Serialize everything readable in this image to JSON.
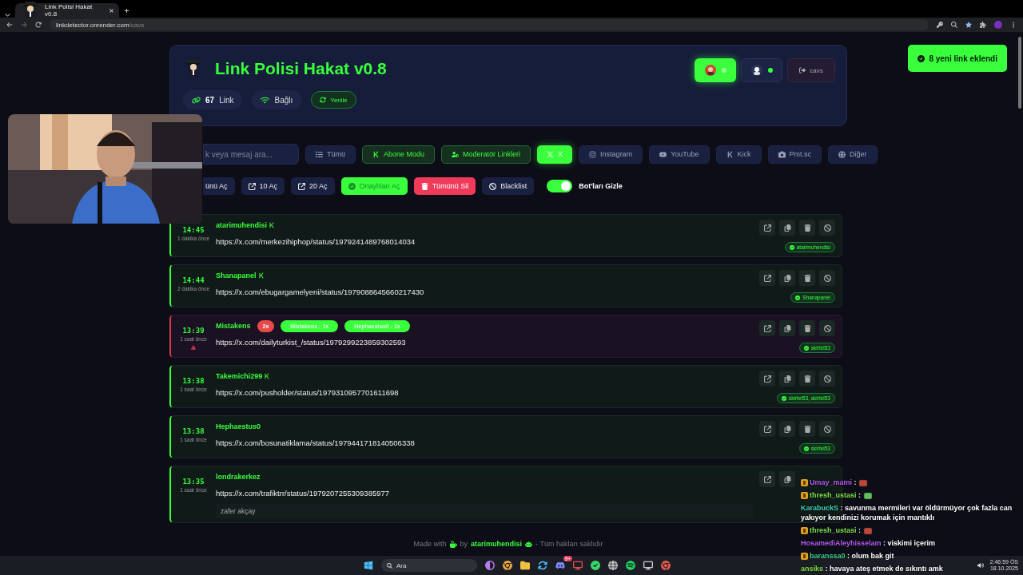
{
  "browser": {
    "tab_title": "Link Polisi Hakat v0.8",
    "url_host": "linkdetector.onrender.com",
    "url_path": "/cavs"
  },
  "header": {
    "title": "Link Polisi Hakat v0.8",
    "link_count": "67",
    "link_label": "Link",
    "connection": "Bağlı",
    "refresh": "Yenile",
    "logout": "cavs",
    "accounts": [
      {
        "selected": true,
        "online": true
      },
      {
        "selected": false,
        "online": true
      }
    ]
  },
  "toast": "8 yeni link eklendi",
  "search": {
    "placeholder": "k veya mesaj ara..."
  },
  "filters": [
    {
      "label": "Tümü",
      "selected": false,
      "kind": "plain"
    },
    {
      "label": "Abone Modu",
      "selected": false,
      "kind": "mode"
    },
    {
      "label": "Moderatör Linkleri",
      "selected": false,
      "kind": "mode"
    },
    {
      "label": "X",
      "selected": true,
      "kind": "plain"
    },
    {
      "label": "Instagram",
      "selected": false,
      "kind": "plain"
    },
    {
      "label": "YouTube",
      "selected": false,
      "kind": "plain"
    },
    {
      "label": "Kick",
      "selected": false,
      "kind": "plain"
    },
    {
      "label": "Pmt.sc",
      "selected": false,
      "kind": "plain"
    },
    {
      "label": "Diğer",
      "selected": false,
      "kind": "plain"
    }
  ],
  "actions": [
    {
      "label": "ünü Aç",
      "kind": "plain"
    },
    {
      "label": "10 Aç",
      "kind": "plain"
    },
    {
      "label": "20 Aç",
      "kind": "plain"
    },
    {
      "label": "Onaylıları Aç",
      "kind": "primary"
    },
    {
      "label": "Tümünü Sil",
      "kind": "danger"
    },
    {
      "label": "Blacklist",
      "kind": "plain"
    }
  ],
  "bot_toggle": {
    "label": "Bot'ları Gizle",
    "on": true
  },
  "links": [
    {
      "time": "14:45",
      "ago": "1 dakika önce",
      "user": "atarimuhendisi",
      "subscriber": true,
      "flagged": false,
      "url": "https://x.com/merkezihiphop/status/1979241489768014034",
      "tools": [
        {
          "kind": "open"
        },
        {
          "kind": "copy"
        },
        {
          "kind": "delete"
        },
        {
          "kind": "block"
        }
      ],
      "approvers": "atarimuhendisi"
    },
    {
      "time": "14:44",
      "ago": "2 dakika önce",
      "user": "Shanapanel",
      "subscriber": true,
      "flagged": false,
      "url": "https://x.com/ebugargamelyeni/status/1979088645660217430",
      "tools": [
        {
          "kind": "open"
        },
        {
          "kind": "copy"
        },
        {
          "kind": "delete"
        },
        {
          "kind": "block"
        }
      ],
      "approvers": "Shanapanel"
    },
    {
      "time": "13:39",
      "ago": "1 saat önce",
      "user": "Mistakens",
      "subscriber": false,
      "flagged": true,
      "duplicates": "2x",
      "mentions": [
        "Mistakens - 1x",
        "Hephaestus0 - 1x"
      ],
      "url": "https://x.com/dailyturkist_/status/1979299223859302593",
      "tools": [
        {
          "kind": "open"
        },
        {
          "kind": "copy"
        },
        {
          "kind": "delete"
        },
        {
          "kind": "block"
        }
      ],
      "approvers": "skirtel53"
    },
    {
      "time": "13:38",
      "ago": "1 saat önce",
      "user": "Takemichi299",
      "subscriber": true,
      "flagged": false,
      "url": "https://x.com/pusholder/status/1979310957701611698",
      "tools": [
        {
          "kind": "open"
        },
        {
          "kind": "copy"
        },
        {
          "kind": "delete"
        },
        {
          "kind": "block"
        }
      ],
      "approvers": "skirtel53, skirtel53"
    },
    {
      "time": "13:38",
      "ago": "1 saat önce",
      "user": "Hephaestus0",
      "subscriber": false,
      "flagged": false,
      "url": "https://x.com/bosunatiklama/status/1979441718140506338",
      "tools": [
        {
          "kind": "open"
        },
        {
          "kind": "copy"
        },
        {
          "kind": "delete"
        },
        {
          "kind": "block"
        }
      ],
      "approvers": "skirtel53"
    },
    {
      "time": "13:35",
      "ago": "1 saat önce",
      "user": "londrakerkez",
      "subscriber": false,
      "flagged": false,
      "url": "https://x.com/trafiktrr/status/1979207255309385977",
      "tools": [
        {
          "kind": "open"
        },
        {
          "kind": "copy"
        }
      ],
      "note": "zafer akçay"
    }
  ],
  "footer": {
    "made_with": "Made with",
    "by": "by",
    "author": "atarimuhendisi",
    "rights": "- Tüm hakları saklıdır"
  },
  "chat": {
    "separator": ":",
    "messages": [
      {
        "user": "Umay_mami",
        "color": "#b45cf0",
        "badge": true,
        "emote": true
      },
      {
        "user": "thresh_ustasi",
        "color": "#7ee04a",
        "badge": true,
        "emote": true
      },
      {
        "user": "KarabuckS",
        "color": "#3fd1b4",
        "badge": false,
        "emote": false,
        "text": "savunma mermileri var öldürmüyor çok fazla can yakıyor kendinizi korumak için mantıklı"
      },
      {
        "user": "thresh_ustasi",
        "color": "#7ee04a",
        "badge": true,
        "emote": true
      },
      {
        "user": "HosamediAleyhisselam",
        "color": "#b45cf0",
        "badge": false,
        "emote": false,
        "text": "viskimi içerim"
      },
      {
        "user": "baranssa0",
        "color": "#3ccf8e",
        "badge": true,
        "emote": false,
        "text": "olum bak git"
      },
      {
        "user": "ansiks",
        "color": "#7ee04a",
        "badge": false,
        "emote": false,
        "text": "havaya ateş etmek de sıkıntı amk"
      }
    ]
  },
  "taskbar": {
    "search": "Ara",
    "notification_count": "9+",
    "time": "2:46:59 ÖS",
    "date": "18.10.2025"
  }
}
